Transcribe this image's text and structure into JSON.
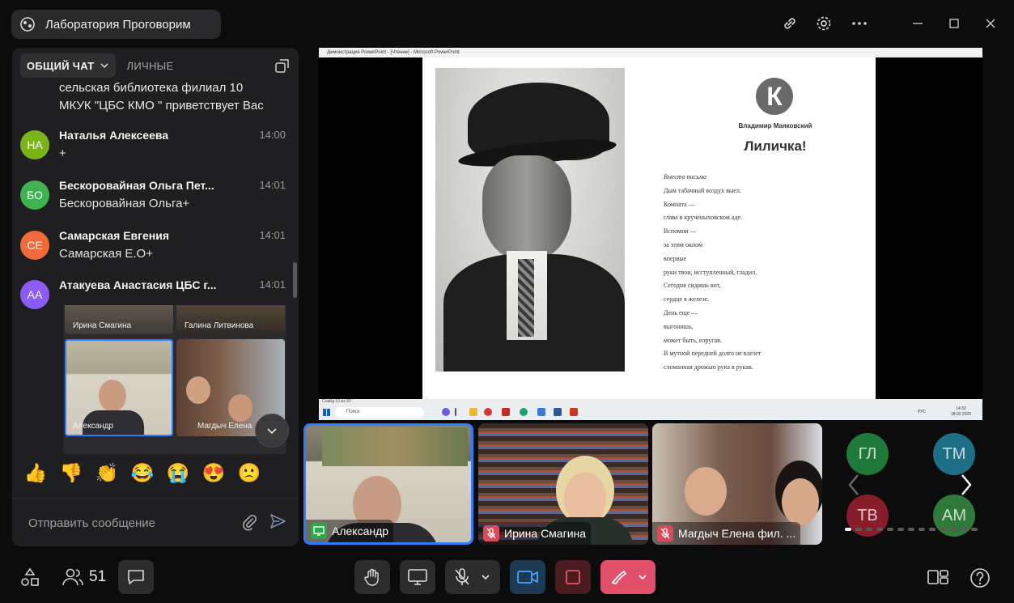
{
  "header": {
    "room_name": "Лаборатория Проговорим"
  },
  "chat": {
    "tab_general": "ОБЩИЙ ЧАТ",
    "tab_private": "ЛИЧНЫЕ",
    "partial_message_line1": "сельская библиотека филиал 10",
    "partial_message_line2": "МКУК \"ЦБС КМО \" приветствует Вас",
    "messages": [
      {
        "initials": "НА",
        "author": "Наталья Алексеева",
        "time": "14:00",
        "text": "+",
        "color": "#7bb31a"
      },
      {
        "initials": "БО",
        "author": "Бескоровайная Ольга Пет...",
        "time": "14:01",
        "text": "Бескоровайная Ольга+",
        "color": "#3fb34f"
      },
      {
        "initials": "СЕ",
        "author": "Самарская Евгения",
        "time": "14:01",
        "text": "Самарская Е.О+",
        "color": "#f06a3b"
      },
      {
        "initials": "АА",
        "author": "Атакуева Анастасия ЦБС г...",
        "time": "14:01",
        "text": "",
        "color": "#8a5cf5"
      }
    ],
    "preview": {
      "name_top_left": "Ирина Смагина",
      "name_top_right": "Галина Литвинова",
      "name_bottom_left": "Александр",
      "name_bottom_right": "Магдыч Елена"
    },
    "reactions": [
      "👍",
      "👎",
      "👏",
      "😂",
      "😭",
      "😍",
      "🙁"
    ],
    "composer_placeholder": "Отправить сообщение"
  },
  "presentation": {
    "window_title": "Демонстрация PowerPoint - [Чтение] - Microsoft PowerPoint",
    "logo_letter": "К",
    "poet": "Владимир Маяковский",
    "title": "Лиличка!",
    "epigraph": "Вместо письма",
    "lines": [
      "Дым табачный воздух выел.",
      "Комната —",
      "глава в крученыховском аде.",
      "Вспомни —",
      "за этим окном",
      "впервые",
      "руки твои, исступленный, гладил.",
      "Сегодня сидишь вот,",
      "сердце в железе.",
      "День еще —",
      "выгонишь,",
      "может быть, изругав.",
      "В мутной передней долго не влезет",
      "сломанная дрожью рука в рукав."
    ],
    "status": "Слайд 10 из 30",
    "taskbar_search": "Поиск",
    "clock_time": "14:32",
    "clock_date": "18.02.2025",
    "lang": "РУС"
  },
  "participants": {
    "tiles": [
      {
        "name": "Александр",
        "status_icon": "screen-share-icon"
      },
      {
        "name": "Ирина Смагина",
        "status_icon": "mic-off-icon"
      },
      {
        "name": "Магдыч Елена фил. ...",
        "status_icon": "mic-off-icon"
      }
    ],
    "grid": [
      {
        "initials": "ГЛ",
        "color": "#1f7a3a"
      },
      {
        "initials": "ТМ",
        "color": "#1d6f86"
      },
      {
        "initials": "ТВ",
        "color": "#8a1d2a"
      },
      {
        "initials": "АМ",
        "color": "#2f7a3a"
      }
    ]
  },
  "toolbar": {
    "participant_count": "51"
  },
  "colors": {
    "accent": "#2d7bff",
    "hangup": "#e0506a",
    "record": "#7a1f24"
  }
}
